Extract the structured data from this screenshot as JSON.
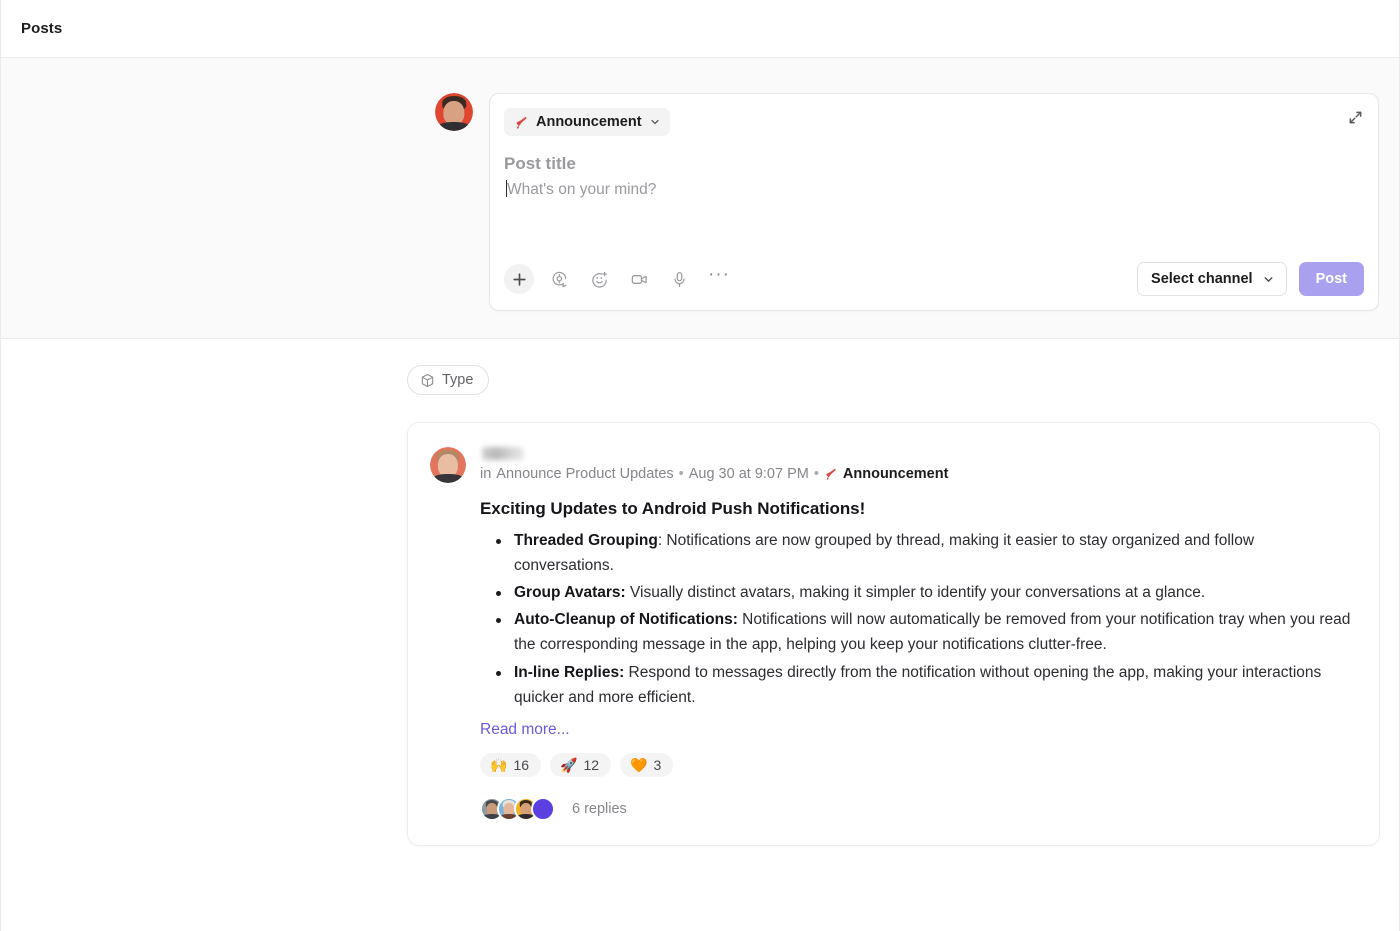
{
  "header": {
    "title": "Posts"
  },
  "composer": {
    "avatar_alt": "user-avatar",
    "type_chip": {
      "label": "Announcement",
      "icon": "megaphone-icon",
      "color": "#d94b41"
    },
    "title_placeholder": "Post title",
    "body_placeholder": "What's on your mind?",
    "expand_icon": "expand-icon",
    "tools": [
      {
        "name": "add-attachment-icon",
        "label": "+"
      },
      {
        "name": "mention-icon",
        "label": ""
      },
      {
        "name": "emoji-icon",
        "label": ""
      },
      {
        "name": "video-icon",
        "label": ""
      },
      {
        "name": "microphone-icon",
        "label": ""
      },
      {
        "name": "more-options-icon",
        "label": "···"
      }
    ],
    "channel_select": {
      "label": "Select channel",
      "icon": "chevron-down-icon"
    },
    "post_button": {
      "label": "Post",
      "color": "#a9a0ef",
      "disabled": true
    }
  },
  "filters": {
    "type_chip": {
      "label": "Type",
      "icon": "cube-icon"
    }
  },
  "post": {
    "author": "",
    "author_redacted": true,
    "channel_prefix": "in",
    "channel": "Announce Product Updates",
    "separator": "•",
    "timestamp": "Aug 30 at 9:07 PM",
    "badge": {
      "label": "Announcement",
      "icon": "megaphone-icon",
      "color": "#d94b41"
    },
    "heading": "Exciting Updates to Android Push Notifications!",
    "bullets": [
      {
        "bold": "Threaded Grouping",
        "rest": ": Notifications are now grouped by thread, making it easier to stay organized and follow conversations."
      },
      {
        "bold": "Group Avatars:",
        "rest": " Visually distinct avatars, making it simpler to identify your conversations at a glance."
      },
      {
        "bold": "Auto-Cleanup of Notifications:",
        "rest": " Notifications will now automatically be removed from your notification tray when you read the corresponding message in the app, helping you keep your notifications clutter-free."
      },
      {
        "bold": "In-line Replies:",
        "rest": " Respond to messages directly from the notification without opening the app, making your interactions quicker and more efficient."
      }
    ],
    "read_more": "Read more...",
    "read_more_color": "#6a5cdb",
    "reactions": [
      {
        "emoji": "🙌",
        "count": "16"
      },
      {
        "emoji": "🚀",
        "count": "12"
      },
      {
        "emoji": "🧡",
        "count": "3"
      }
    ],
    "replies_label": "6 replies",
    "reply_avatars": [
      {
        "name": "reply-avatar-1",
        "bg": "#8d9ca2"
      },
      {
        "name": "reply-avatar-2",
        "bg": "#7ab4da"
      },
      {
        "name": "reply-avatar-3",
        "bg": "#f0b429"
      },
      {
        "name": "reply-avatar-4",
        "bg": "#5b3fe0"
      }
    ]
  }
}
